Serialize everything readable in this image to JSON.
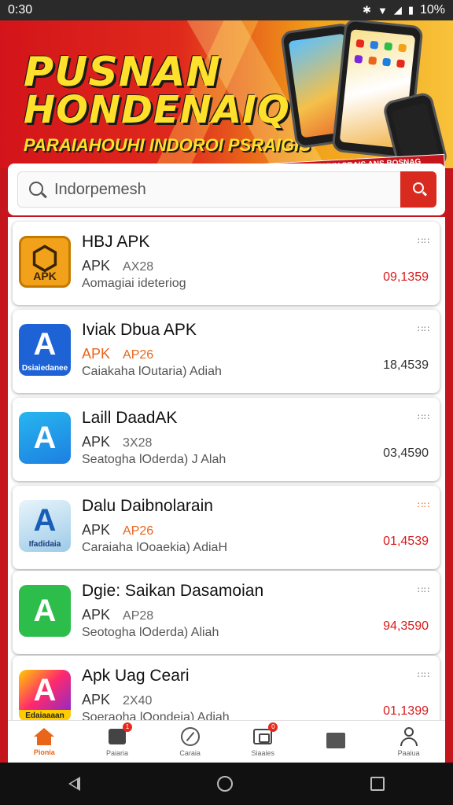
{
  "statusbar": {
    "time": "0:30",
    "battery": "10%",
    "icons": [
      "bluetooth-icon",
      "wifi-icon",
      "signal-icon",
      "battery-icon"
    ]
  },
  "banner": {
    "title_line1": "PUSNAN",
    "title_line2": "HONDENAIQ",
    "subtitle": "PARAIAHOUHI INDOROI PSRAIGIS",
    "tag": "BGEOSKGHHY SRAIS ANS BOSNAG RPEXCSAYSUJIGAI VIANGSNDNAEIGE"
  },
  "search": {
    "value": "Indorpemesh",
    "button_icon": "search-icon"
  },
  "apps": [
    {
      "title": "HBJ APK",
      "tag": "APK",
      "version": "AX28",
      "desc": "Aomagiai ideteriog",
      "dots": "∷∷",
      "price": "09,1359",
      "hot": false
    },
    {
      "title": "Iviak Dbua APK",
      "tag": "APK",
      "version": "AP26",
      "desc": "Caiakaha lOutaria) Adiah",
      "dots": "∷∷",
      "price": "18,4539",
      "hot": true
    },
    {
      "title": "Laill DaadAK",
      "tag": "APK",
      "version": "3X28",
      "desc": "Seatogha lOderda) J Alah",
      "dots": "∷∷",
      "price": "03,4590",
      "hot": false
    },
    {
      "title": "Dalu Daibnolarain",
      "tag": "APK",
      "version": "AP26",
      "desc": "Caraiaha lOoaekia) AdiaH",
      "dots": "∷∷",
      "price": "01,4539",
      "hot": true
    },
    {
      "title": "Dgie: Saikan Dasamoian",
      "tag": "APK",
      "version": "AP28",
      "desc": "Seotogha lOderda) Aliah",
      "dots": "∷∷",
      "price": "94,3590",
      "hot": false
    },
    {
      "title": "Apk Uag Ceari",
      "tag": "APK",
      "version": "2X40",
      "desc": "Soeraoha lOondeia) Adiah",
      "dots": "∷∷",
      "price": "01,1399",
      "hot": false
    }
  ],
  "icon_captions": [
    "APK",
    "Dsiaiedanee",
    "",
    "Ifadidaia",
    "",
    "Edaiaaaan"
  ],
  "nav": [
    {
      "label": "Pionia",
      "icon": "home-icon",
      "active": true
    },
    {
      "label": "Paiaria",
      "icon": "briefcase-icon",
      "badge": "1"
    },
    {
      "label": "Caraia",
      "icon": "compass-icon"
    },
    {
      "label": "Siaaies",
      "icon": "frame-icon",
      "badge": "0"
    },
    {
      "label": "",
      "icon": "grid-icon"
    },
    {
      "label": "Paaiua",
      "icon": "user-icon"
    }
  ],
  "colors": {
    "brand_red": "#c4161c",
    "accent_orange": "#e8651a",
    "banner_yellow": "#ffe02a",
    "price_red": "#d81b1b"
  }
}
